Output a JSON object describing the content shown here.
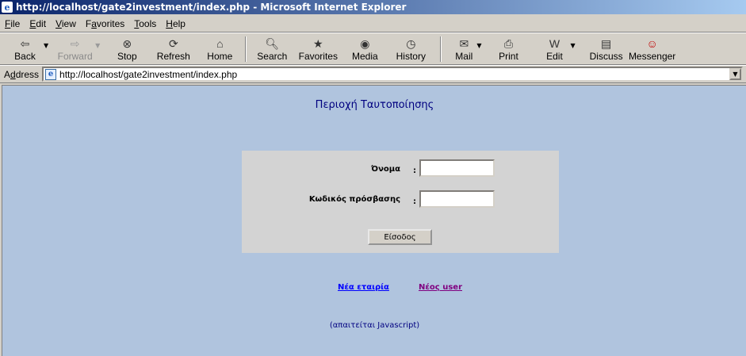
{
  "window": {
    "title": "http://localhost/gate2investment/index.php - Microsoft Internet Explorer"
  },
  "menu": {
    "items": [
      {
        "u": "F",
        "rest": "ile"
      },
      {
        "u": "E",
        "rest": "dit"
      },
      {
        "u": "V",
        "rest": "iew"
      },
      {
        "pre": "F",
        "u": "a",
        "rest": "vorites"
      },
      {
        "u": "T",
        "rest": "ools"
      },
      {
        "u": "H",
        "rest": "elp"
      }
    ]
  },
  "toolbar": {
    "back": "Back",
    "forward": "Forward",
    "stop": "Stop",
    "refresh": "Refresh",
    "home": "Home",
    "search": "Search",
    "favorites": "Favorites",
    "media": "Media",
    "history": "History",
    "mail": "Mail",
    "print": "Print",
    "edit": "Edit",
    "discuss": "Discuss",
    "messenger": "Messenger"
  },
  "address": {
    "label_u": "d",
    "label_pre": "A",
    "label_rest": "dress",
    "url": "http://localhost/gate2investment/index.php"
  },
  "page": {
    "title": "Περιοχή Ταυτοποίησης",
    "username_label": "Όνομα",
    "password_label": "Κωδικός πρόσβασης",
    "colon": ":",
    "username_value": "",
    "password_value": "",
    "submit_label": "Είσοδος",
    "new_company_link": "Νέα εταιρία",
    "new_user_link": "Νέος user",
    "js_note": "(απαιτείται Javascript)"
  }
}
